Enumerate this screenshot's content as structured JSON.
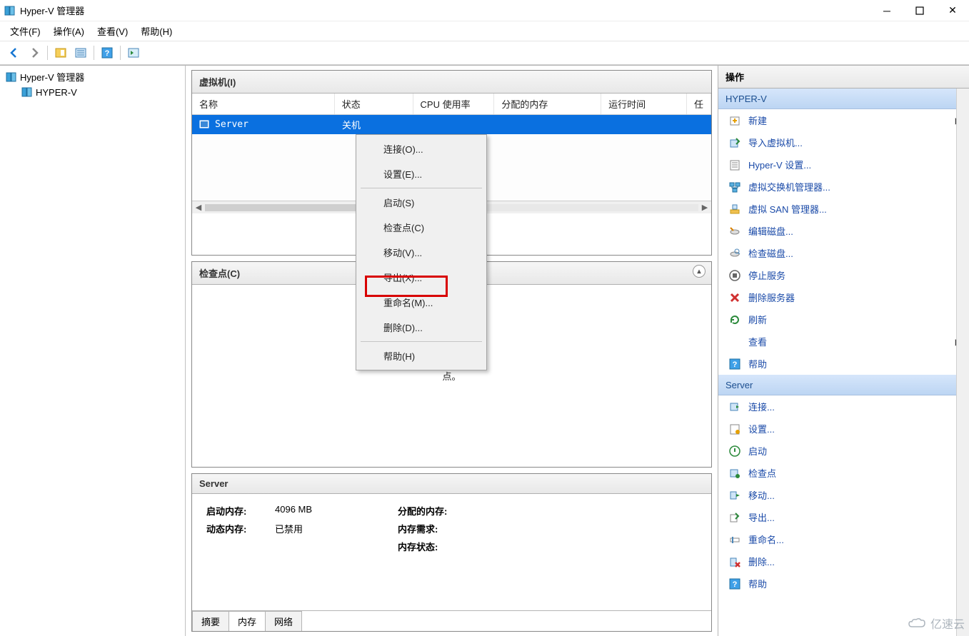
{
  "title": "Hyper-V 管理器",
  "menu": [
    "文件(F)",
    "操作(A)",
    "查看(V)",
    "帮助(H)"
  ],
  "tree": {
    "root": "Hyper-V 管理器",
    "child": "HYPER-V"
  },
  "vm_panel": {
    "header": "虚拟机(I)",
    "columns": [
      "名称",
      "状态",
      "CPU 使用率",
      "分配的内存",
      "运行时间",
      "任"
    ],
    "row": {
      "name": "Server",
      "state": "关机"
    }
  },
  "context_menu": [
    "连接(O)...",
    "设置(E)...",
    "-",
    "启动(S)",
    "检查点(C)",
    "移动(V)...",
    "导出(X)...",
    "重命名(M)...",
    "删除(D)...",
    "-",
    "帮助(H)"
  ],
  "checkpoints_panel": {
    "header": "检查点(C)",
    "hint_fragment": "点。"
  },
  "details_panel": {
    "header": "Server",
    "left": [
      {
        "label": "启动内存:",
        "value": "4096 MB"
      },
      {
        "label": "动态内存:",
        "value": "已禁用"
      }
    ],
    "right": [
      {
        "label": "分配的内存:",
        "value": ""
      },
      {
        "label": "内存需求:",
        "value": ""
      },
      {
        "label": "内存状态:",
        "value": ""
      }
    ],
    "tabs": [
      "摘要",
      "内存",
      "网络"
    ],
    "active_tab": 1
  },
  "actions": {
    "title": "操作",
    "section_hyperv": {
      "header": "HYPER-V",
      "items": [
        {
          "icon": "new-icon",
          "label": "新建",
          "caret": true
        },
        {
          "icon": "import-icon",
          "label": "导入虚拟机..."
        },
        {
          "icon": "settings-icon",
          "label": "Hyper-V 设置..."
        },
        {
          "icon": "vswitch-icon",
          "label": "虚拟交换机管理器..."
        },
        {
          "icon": "san-icon",
          "label": "虚拟 SAN 管理器..."
        },
        {
          "icon": "edit-disk-icon",
          "label": "编辑磁盘..."
        },
        {
          "icon": "inspect-disk-icon",
          "label": "检查磁盘..."
        },
        {
          "icon": "stop-icon",
          "label": "停止服务"
        },
        {
          "icon": "delete-server-icon",
          "label": "删除服务器"
        },
        {
          "icon": "refresh-icon",
          "label": "刷新"
        },
        {
          "icon": "view-icon",
          "label": "查看",
          "caret": true
        },
        {
          "icon": "help-icon",
          "label": "帮助"
        }
      ]
    },
    "section_server": {
      "header": "Server",
      "items": [
        {
          "icon": "connect-icon",
          "label": "连接..."
        },
        {
          "icon": "settings-vm-icon",
          "label": "设置..."
        },
        {
          "icon": "start-icon",
          "label": "启动"
        },
        {
          "icon": "checkpoint-icon",
          "label": "检查点"
        },
        {
          "icon": "move-icon",
          "label": "移动..."
        },
        {
          "icon": "export-icon",
          "label": "导出..."
        },
        {
          "icon": "rename-icon",
          "label": "重命名..."
        },
        {
          "icon": "delete-icon",
          "label": "删除..."
        },
        {
          "icon": "help-icon",
          "label": "帮助"
        }
      ]
    }
  },
  "watermark": "亿速云"
}
